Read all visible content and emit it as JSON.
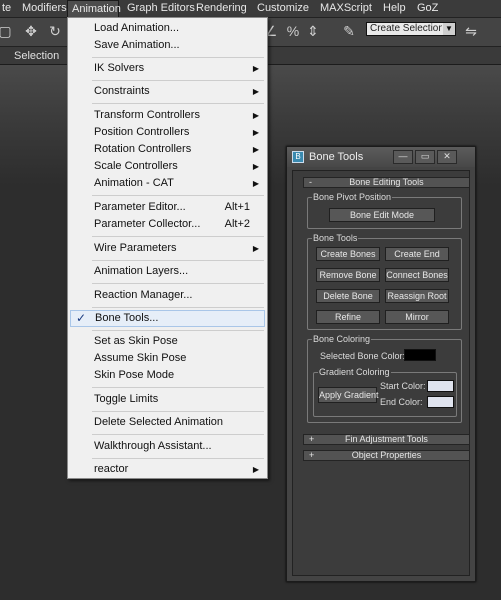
{
  "menubar": {
    "items": [
      "te",
      "Modifiers",
      "Animation",
      "Graph Editors",
      "Rendering",
      "Customize",
      "MAXScript",
      "Help",
      "GoZ"
    ]
  },
  "toolbar": {
    "named_selection_placeholder": "Create Selection Se",
    "icons": [
      "select-region-icon",
      "move-icon",
      "rotate-icon",
      "angle-snap-icon",
      "percent-snap-icon",
      "spinner-snap-icon",
      "edit-named-selection-icon",
      "mirror-icon"
    ]
  },
  "ribbon": {
    "tab": "Selection"
  },
  "animation_menu": {
    "items": [
      {
        "label": "Load Animation..."
      },
      {
        "label": "Save Animation..."
      },
      {
        "label": "IK Solvers",
        "submenu": true
      },
      {
        "label": "Constraints",
        "submenu": true
      },
      {
        "label": "Transform Controllers",
        "submenu": true
      },
      {
        "label": "Position Controllers",
        "submenu": true
      },
      {
        "label": "Rotation Controllers",
        "submenu": true
      },
      {
        "label": "Scale Controllers",
        "submenu": true
      },
      {
        "label": "Animation - CAT",
        "submenu": true
      },
      {
        "label": "Parameter Editor...",
        "shortcut": "Alt+1"
      },
      {
        "label": "Parameter Collector...",
        "shortcut": "Alt+2"
      },
      {
        "label": "Wire Parameters",
        "submenu": true
      },
      {
        "label": "Animation Layers..."
      },
      {
        "label": "Reaction Manager..."
      },
      {
        "label": "Bone Tools...",
        "checked": true
      },
      {
        "label": "Set as Skin Pose"
      },
      {
        "label": "Assume Skin Pose"
      },
      {
        "label": "Skin Pose Mode"
      },
      {
        "label": "Toggle Limits"
      },
      {
        "label": "Delete Selected Animation"
      },
      {
        "label": "Walkthrough Assistant..."
      },
      {
        "label": "reactor",
        "submenu": true
      }
    ]
  },
  "bone_tools": {
    "title": "Bone Tools",
    "window_controls": [
      "minimize",
      "maximize",
      "close"
    ],
    "bone_editing_rollout": {
      "sign": "-",
      "title": "Bone Editing Tools",
      "pivot_group": {
        "label": "Bone Pivot Position",
        "edit_mode_button": "Bone Edit Mode"
      },
      "tools_group": {
        "label": "Bone Tools",
        "buttons": [
          "Create Bones",
          "Create End",
          "Remove Bone",
          "Connect Bones",
          "Delete Bone",
          "Reassign Root",
          "Refine",
          "Mirror"
        ]
      },
      "coloring_group": {
        "label": "Bone Coloring",
        "selected_color_label": "Selected Bone Color:",
        "selected_color": "#000000",
        "gradient": {
          "label": "Gradient Coloring",
          "apply_button": "Apply Gradient",
          "start_label": "Start Color:",
          "end_label": "End Color:",
          "start_color": "#dfe3ee",
          "end_color": "#dfe3ee"
        }
      }
    },
    "fin_rollout": {
      "sign": "+",
      "title": "Fin Adjustment Tools"
    },
    "object_rollout": {
      "sign": "+",
      "title": "Object Properties"
    }
  }
}
